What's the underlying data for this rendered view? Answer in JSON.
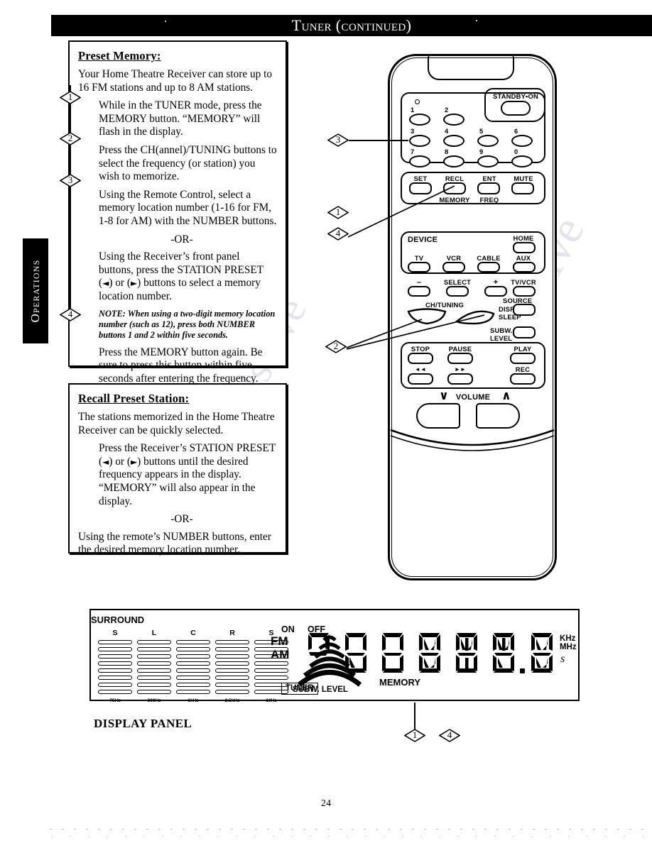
{
  "header": {
    "title": "Tuner (continued)"
  },
  "side_tab": {
    "label": "Operations"
  },
  "page_number": "24",
  "boxes": [
    {
      "heading": "Preset Memory:",
      "intro": "Your Home Theatre Receiver can store up to 16 FM stations and up to 8 AM stations.",
      "steps": [
        {
          "num": "1",
          "text": "While in the TUNER mode, press the MEMORY button. “MEMORY” will flash in the display."
        },
        {
          "num": "2",
          "text": "Press the CH(annel)/TUNING buttons to select the frequency (or station) you wish to memorize."
        },
        {
          "num": "3",
          "text": "Using the Remote Control, select a memory location number (1-16 for FM, 1-8 for AM) with the NUMBER buttons."
        }
      ],
      "or_divider": "-OR-",
      "alt_text_a": "Using the Receiver’s front panel buttons, press the STATION PRESET (",
      "alt_arrow_left": "◄",
      "alt_text_b": ") or (",
      "alt_arrow_right": "►",
      "alt_text_c": ") buttons to select a memory location number.",
      "note": "NOTE: When using a two-digit memory location number (such as 12), press both NUMBER buttons 1 and 2 within five seconds.",
      "final_step": {
        "num": "4",
        "text": "Press the MEMORY button again. Be sure to press this button within five seconds after entering the frequency. “MEMORY” will appear in the display."
      }
    },
    {
      "heading": "Recall Preset Station:",
      "intro": "The stations memorized in the Home Theatre Receiver can be quickly selected.",
      "body_a": "Press the Receiver’s STATION PRESET (",
      "arrow_left": "◄",
      "body_b": ") or (",
      "arrow_right": "►",
      "body_c": ") buttons until the desired frequency appears in the display. “MEMORY” will also appear in the display.",
      "or_divider": "-OR-",
      "tail": "Using the remote’s NUMBER buttons, enter the desired memory location number."
    }
  ],
  "remote": {
    "standby_label": "STANDBY•ON",
    "led_icon": "indicator-led-icon",
    "numbers": [
      "1",
      "2",
      "3",
      "4",
      "5",
      "6",
      "7",
      "8",
      "9",
      "0"
    ],
    "function_row": [
      {
        "top": "SET",
        "bottom": ""
      },
      {
        "top": "RECL",
        "bottom": "MEMORY"
      },
      {
        "top": "ENT",
        "bottom": "FREQ"
      },
      {
        "top": "MUTE",
        "bottom": ""
      }
    ],
    "device_label": "DEVICE",
    "home_label": "HOME",
    "device_buttons": [
      "TV",
      "VCR",
      "CABLE",
      "AUX"
    ],
    "select_row": {
      "minus": "–",
      "select": "SELECT",
      "plus": "+",
      "tvvcr": "TV/VCR"
    },
    "chtuning_label": "CH/TUNING",
    "disp_sleep_label": [
      "DISP/",
      "SLEEP"
    ],
    "source_label": "SOURCE",
    "subw_level_label": [
      "SUBW.",
      "LEVEL"
    ],
    "transport": {
      "row1": [
        "STOP",
        "PAUSE",
        "PLAY"
      ],
      "row2": [
        "◄◄",
        "►►",
        "REC"
      ]
    },
    "volume": {
      "label": "VOLUME",
      "down_icon": "∨",
      "up_icon": "∧"
    }
  },
  "callouts": {
    "remote_markers": [
      "3",
      "1",
      "4",
      "2"
    ],
    "display_markers": [
      "1",
      "4"
    ]
  },
  "display_panel": {
    "title": "DISPLAY PANEL",
    "eq_columns": [
      {
        "channel": "S",
        "freq": "75Hz"
      },
      {
        "channel": "L",
        "freq": "300Hz"
      },
      {
        "channel": "C",
        "freq": "1kHz"
      },
      {
        "channel": "R",
        "freq": "2.5kHz"
      },
      {
        "channel": "S",
        "freq": "10Hz"
      }
    ],
    "eq_segments_per_column": 8,
    "subw_level_label": "SUBW. LEVEL",
    "subw_icon": "subwoofer-arcs-icon",
    "surround_label": "SURROUND",
    "surround_on": "ON",
    "surround_off": "OFF",
    "band_fm": "FM",
    "band_am": "AM",
    "tuner_label": "TUNER",
    "memory_label": "MEMORY",
    "unit_khz": "KHz",
    "unit_mhz": "MHz",
    "unit_small": "s",
    "digits": [
      "P",
      "8",
      "8",
      "8",
      "8",
      "8",
      "8"
    ],
    "decimal_point_after_index": 5
  },
  "colors": {
    "ink": "#000000",
    "paper": "#ffffff",
    "watermark": "#6b5fa8"
  },
  "watermark_text": "manualshive"
}
